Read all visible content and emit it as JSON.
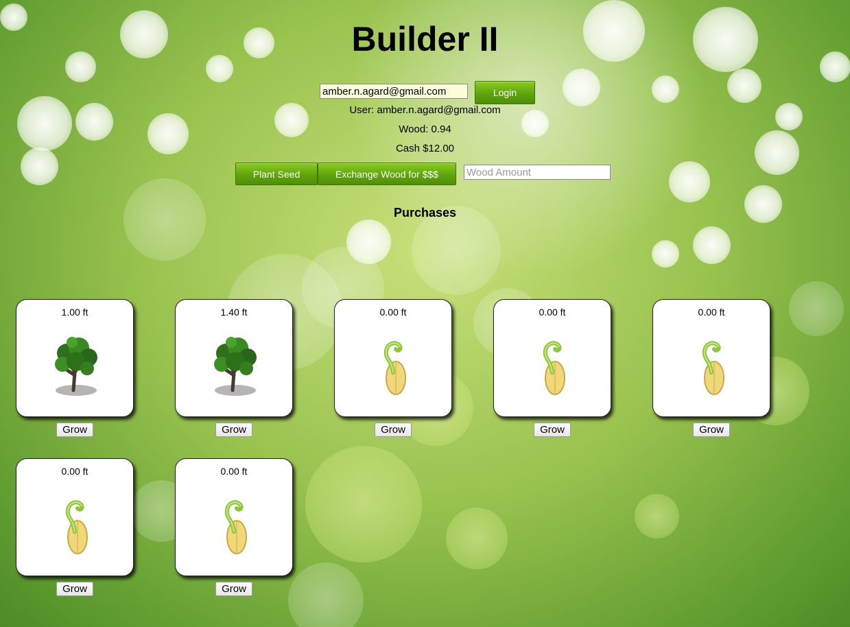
{
  "app": {
    "title": "Builder II"
  },
  "login": {
    "email_value": "amber.n.agard@gmail.com",
    "login_label": "Login"
  },
  "status": {
    "user": "User: amber.n.agard@gmail.com",
    "wood": "Wood: 0.94",
    "cash": "Cash $12.00"
  },
  "actions": {
    "plant_label": "Plant Seed",
    "exchange_label": "Exchange Wood for $$$",
    "wood_placeholder": "Wood Amount"
  },
  "purchases": {
    "heading": "Purchases",
    "grow_label": "Grow",
    "items": [
      {
        "height": "1.00 ft",
        "icon": "tree-icon"
      },
      {
        "height": "1.40 ft",
        "icon": "tree-icon"
      },
      {
        "height": "0.00 ft",
        "icon": "seed-sprout-icon"
      },
      {
        "height": "0.00 ft",
        "icon": "seed-sprout-icon"
      },
      {
        "height": "0.00 ft",
        "icon": "seed-sprout-icon"
      },
      {
        "height": "0.00 ft",
        "icon": "seed-sprout-icon"
      },
      {
        "height": "0.00 ft",
        "icon": "seed-sprout-icon"
      }
    ]
  }
}
